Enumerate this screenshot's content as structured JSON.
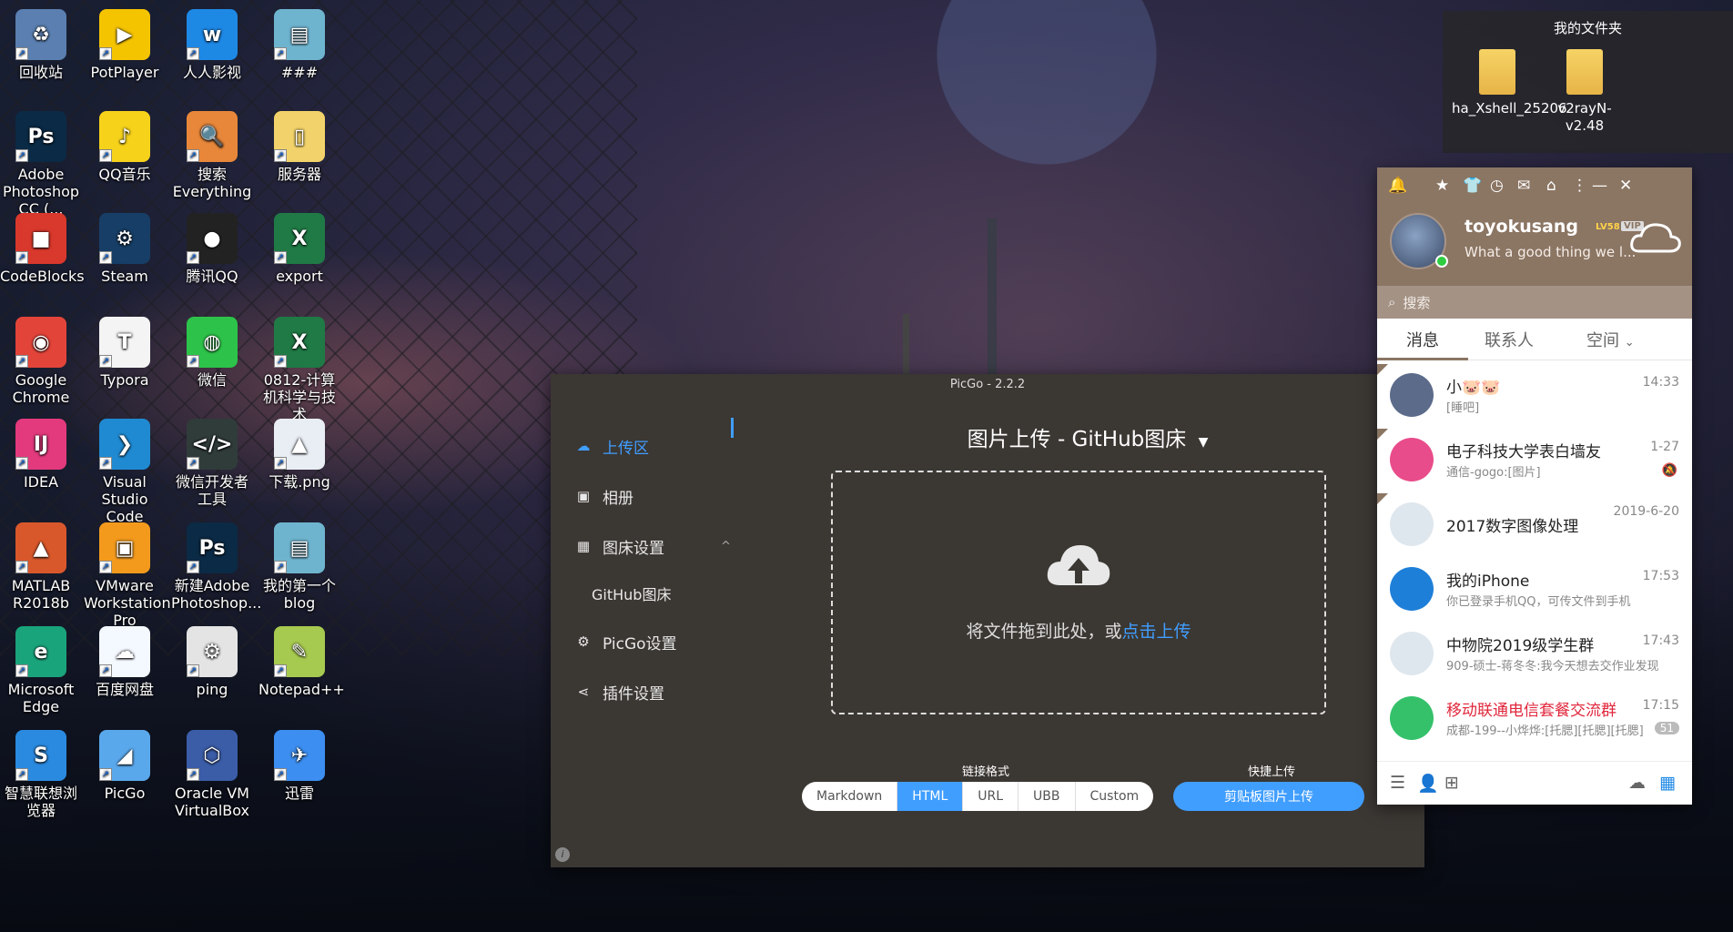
{
  "desktop": {
    "icons": [
      {
        "label": "回收站",
        "color": "#5a7fb0",
        "glyph": "♻"
      },
      {
        "label": "PotPlayer",
        "color": "#f5c400",
        "glyph": "▶"
      },
      {
        "label": "人人影视",
        "color": "#1e88e5",
        "glyph": "w"
      },
      {
        "label": "###",
        "color": "#6fb4cf",
        "glyph": "▤"
      },
      {
        "label": "Adobe Photoshop CC (...",
        "color": "#0b2a45",
        "glyph": "Ps"
      },
      {
        "label": "QQ音乐",
        "color": "#f7d21b",
        "glyph": "♪"
      },
      {
        "label": "搜索 Everything",
        "color": "#e8873a",
        "glyph": "🔍"
      },
      {
        "label": "服务器",
        "color": "#f2d36b",
        "glyph": "▯"
      },
      {
        "label": "CodeBlocks",
        "color": "#d9382c",
        "glyph": "■"
      },
      {
        "label": "Steam",
        "color": "#173e66",
        "glyph": "⚙"
      },
      {
        "label": "腾讯QQ",
        "color": "#222222",
        "glyph": "●"
      },
      {
        "label": "export",
        "color": "#1f7a45",
        "glyph": "X"
      },
      {
        "label": "Google Chrome",
        "color": "#e3443a",
        "glyph": "◉"
      },
      {
        "label": "Typora",
        "color": "#f4f4f4",
        "glyph": "T"
      },
      {
        "label": "微信",
        "color": "#2dc34a",
        "glyph": "◍"
      },
      {
        "label": "0812-计算机科学与技术",
        "color": "#1f7a45",
        "glyph": "X"
      },
      {
        "label": "IDEA",
        "color": "#e33a7d",
        "glyph": "IJ"
      },
      {
        "label": "Visual Studio Code",
        "color": "#1f8ad2",
        "glyph": "❯"
      },
      {
        "label": "微信开发者工具",
        "color": "#303c3a",
        "glyph": "</>"
      },
      {
        "label": "下载.png",
        "color": "#e9eef5",
        "glyph": "▲"
      },
      {
        "label": "MATLAB R2018b",
        "color": "#d9582b",
        "glyph": "▲"
      },
      {
        "label": "VMware Workstation Pro",
        "color": "#f39a1d",
        "glyph": "▣"
      },
      {
        "label": "新建Adobe Photoshop...",
        "color": "#0b2a45",
        "glyph": "Ps"
      },
      {
        "label": "我的第一个blog",
        "color": "#6fb4cf",
        "glyph": "▤"
      },
      {
        "label": "Microsoft Edge",
        "color": "#1aa47c",
        "glyph": "e"
      },
      {
        "label": "百度网盘",
        "color": "#f4f8ff",
        "glyph": "☁"
      },
      {
        "label": "ping",
        "color": "#e4e4e4",
        "glyph": "⚙"
      },
      {
        "label": "Notepad++",
        "color": "#a6c94f",
        "glyph": "✎"
      },
      {
        "label": "智慧联想浏览器",
        "color": "#2a8ae0",
        "glyph": "S"
      },
      {
        "label": "PicGo",
        "color": "#5aa8ec",
        "glyph": "◢"
      },
      {
        "label": "Oracle VM VirtualBox",
        "color": "#3b5da8",
        "glyph": "⬡"
      },
      {
        "label": "迅雷",
        "color": "#3c8ef0",
        "glyph": "✈"
      }
    ]
  },
  "folder_window": {
    "title": "我的文件夹",
    "items": [
      {
        "label": "ha_Xshell_25206"
      },
      {
        "label": "v2rayN-v2.48"
      }
    ]
  },
  "picgo": {
    "title": "PicGo - 2.2.2",
    "minimize": "—",
    "nav": [
      {
        "label": "上传区",
        "icon": "☁",
        "active": true
      },
      {
        "label": "相册",
        "icon": "▣",
        "active": false
      },
      {
        "label": "图床设置",
        "icon": "▦",
        "active": false,
        "chevron": "^"
      },
      {
        "label": "GitHub图床",
        "icon": "",
        "active": false
      },
      {
        "label": "PicGo设置",
        "icon": "⚙",
        "active": false
      },
      {
        "label": "插件设置",
        "icon": "⋖",
        "active": false
      }
    ],
    "heading": "图片上传 - GitHub图床",
    "drop_text": "将文件拖到此处，或",
    "drop_link": "点击上传",
    "link_format_label": "链接格式",
    "quick_upload_label": "快捷上传",
    "formats": [
      "Markdown",
      "HTML",
      "URL",
      "UBB",
      "Custom"
    ],
    "active_format": "HTML",
    "clipboard_button": "剪贴板图片上传",
    "info": "i"
  },
  "qq": {
    "username": "toyokusang",
    "vip1": "LV58",
    "vip2": "VIP",
    "signature": "What a good thing we l...",
    "search_placeholder": "搜索",
    "tabs": [
      "消息",
      "联系人",
      "空间"
    ],
    "space_chevron": "⌄",
    "conversations": [
      {
        "name": "小🐷🐷",
        "message": "[睡吧]",
        "time": "14:33",
        "avatar_color": "#5c6b8a",
        "pinned": true
      },
      {
        "name": "电子科技大学表白墙友",
        "message": "通信-gogo:[图片]",
        "time": "1-27",
        "avatar_color": "#e84c8a",
        "pinned": true,
        "muted": true
      },
      {
        "name": "2017数字图像处理",
        "message": "",
        "time": "2019-6-20",
        "avatar_color": "#dfe7ee",
        "pinned": true
      },
      {
        "name": "我的iPhone",
        "message": "你已登录手机QQ，可传文件到手机",
        "time": "17:53",
        "avatar_color": "#1e7fd8"
      },
      {
        "name": "中物院2019级学生群",
        "message": "909-硕士-蒋冬冬:我今天想去交作业发现",
        "time": "17:43",
        "avatar_color": "#dfe7ee"
      },
      {
        "name": "移动联通电信套餐交流群",
        "message": "成都-199--小烨烨:[托腮][托腮][托腮]",
        "time": "17:15",
        "avatar_color": "#34c16a",
        "red": true,
        "badge": "51"
      }
    ],
    "footer_icons": [
      "menu-icon",
      "add-contact-icon",
      "apps-icon",
      "cloud-icon",
      "grid-icon"
    ]
  }
}
